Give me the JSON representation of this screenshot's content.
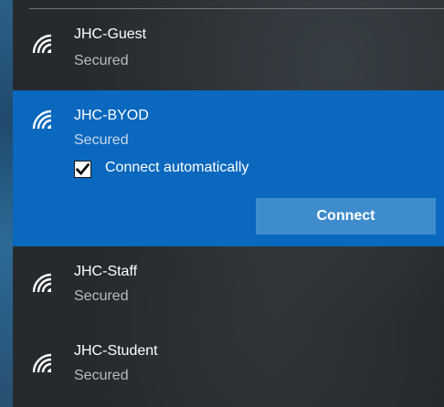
{
  "networks": [
    {
      "name": "JHC-Guest",
      "status": "Secured",
      "icon": "wifi-icon"
    },
    {
      "name": "JHC-BYOD",
      "status": "Secured",
      "icon": "wifi-icon",
      "selected": true
    },
    {
      "name": "JHC-Staff",
      "status": "Secured",
      "icon": "wifi-icon"
    },
    {
      "name": "JHC-Student",
      "status": "Secured",
      "icon": "wifi-icon"
    }
  ],
  "selected_network": {
    "connect_automatically_label": "Connect automatically",
    "connect_automatically_checked": true,
    "connect_button_label": "Connect"
  },
  "colors": {
    "selected_background": "#0a68be",
    "connect_button": "#3f8ccd",
    "flyout_background": "#262a2d",
    "secondary_text": "#b7bcc0"
  }
}
